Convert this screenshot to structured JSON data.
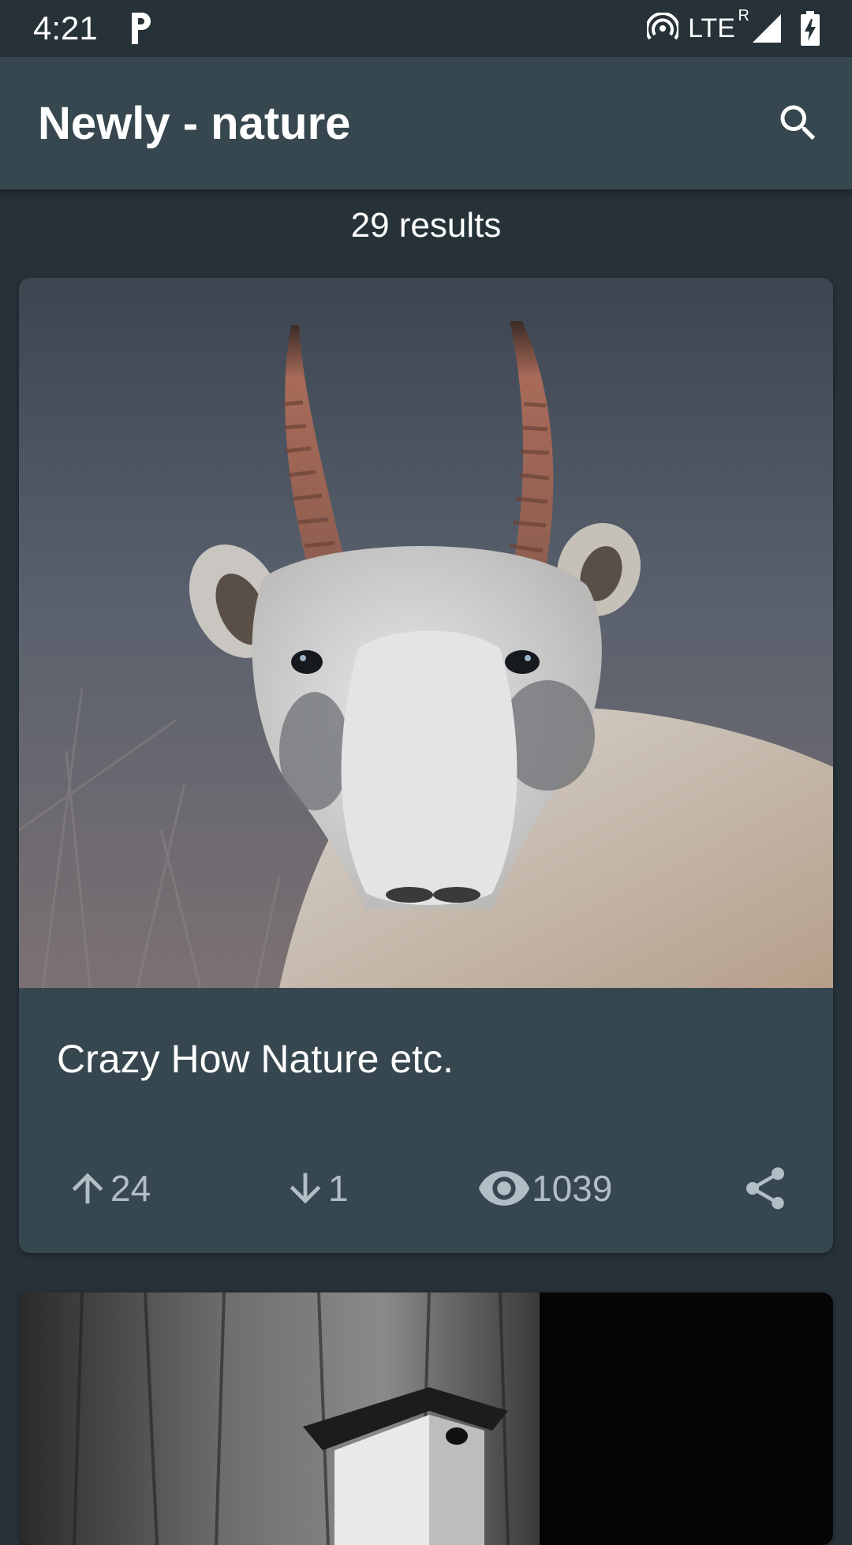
{
  "status_bar": {
    "time": "4:21",
    "network": "LTE",
    "roaming": "R",
    "icons": [
      "parking-icon",
      "hotspot-icon",
      "signal-icon",
      "battery-charging-icon"
    ]
  },
  "app_bar": {
    "title": "Newly - nature",
    "search_icon": "search-icon"
  },
  "results_text": "29 results",
  "posts": [
    {
      "title": "Crazy How Nature etc.",
      "image": "saiga-antelope-photo",
      "upvotes": "24",
      "downvotes": "1",
      "views": "1039",
      "share_icon": "share-icon"
    },
    {
      "title": "",
      "image": "birdhouse-on-tree-photo"
    }
  ],
  "colors": {
    "background": "#263238",
    "app_bar": "#37474f",
    "card": "#37474f",
    "action_text": "#b0bec5"
  }
}
